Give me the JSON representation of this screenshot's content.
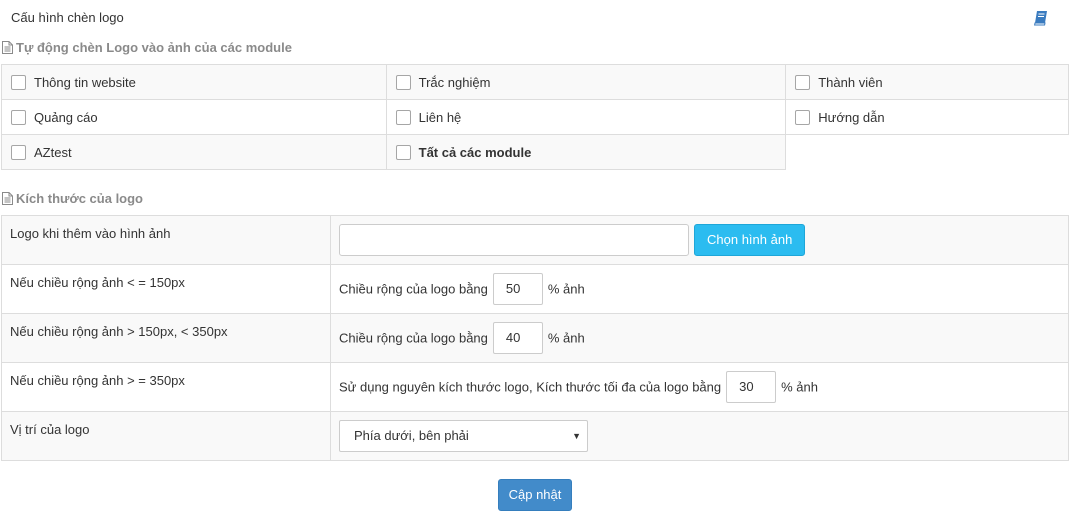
{
  "page": {
    "title": "Cấu hình chèn logo",
    "help_icon": "book-icon"
  },
  "modules_section": {
    "heading": "Tự động chèn Logo vào ảnh của các module",
    "icon": "document-icon",
    "rows": [
      [
        {
          "label": "Thông tin website",
          "checked": false,
          "bold": false
        },
        {
          "label": "Trắc nghiệm",
          "checked": false,
          "bold": false
        },
        {
          "label": "Thành viên",
          "checked": false,
          "bold": false
        }
      ],
      [
        {
          "label": "Quảng cáo",
          "checked": false,
          "bold": false
        },
        {
          "label": "Liên hệ",
          "checked": false,
          "bold": false
        },
        {
          "label": "Hướng dẫn",
          "checked": false,
          "bold": false
        }
      ],
      [
        {
          "label": "AZtest",
          "checked": false,
          "bold": false
        },
        {
          "label": "Tất cả các module",
          "checked": false,
          "bold": true
        }
      ]
    ]
  },
  "size_section": {
    "heading": "Kích thước của logo",
    "icon": "document-icon",
    "logo_row": {
      "label": "Logo khi thêm vào hình ảnh",
      "input_value": "",
      "button_label": "Chọn hình ảnh"
    },
    "small_row": {
      "label": "Nếu chiều rộng ảnh < = 150px",
      "prefix": "Chiều rộng của logo bằng",
      "value": "50",
      "suffix": "% ảnh"
    },
    "medium_row": {
      "label": "Nếu chiều rộng ảnh > 150px, < 350px",
      "prefix": "Chiều rộng của logo bằng",
      "value": "40",
      "suffix": "% ảnh"
    },
    "large_row": {
      "label": "Nếu chiều rộng ảnh > = 350px",
      "prefix": "Sử dụng nguyên kích thước logo, Kích thước tối đa của logo bằng",
      "value": "30",
      "suffix": "% ảnh"
    },
    "position_row": {
      "label": "Vị trí của logo",
      "selected": "Phía dưới, bên phải"
    }
  },
  "submit_label": "Cập nhật",
  "colors": {
    "primary_button": "#428bca",
    "choose_button": "#2bbcf0",
    "heading_text": "#8a8a8a"
  }
}
